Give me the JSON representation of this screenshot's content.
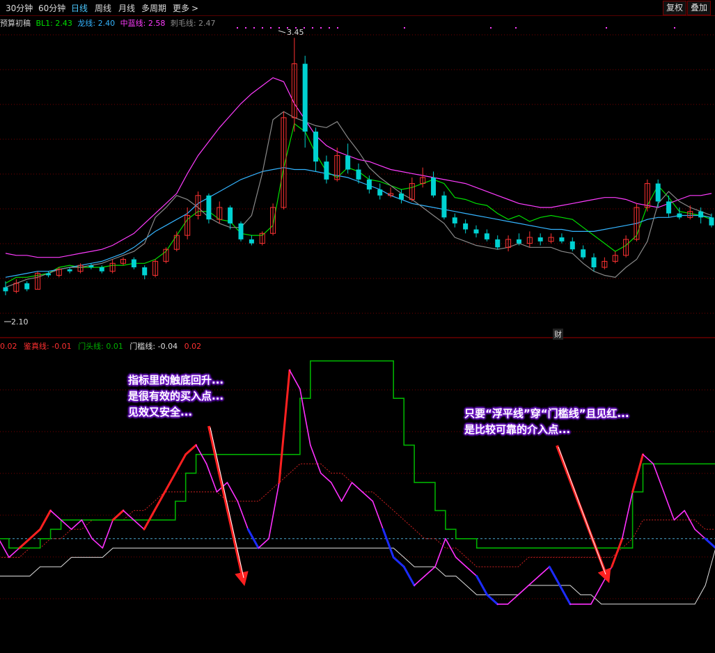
{
  "toolbar": {
    "tabs": [
      "30分钟",
      "60分钟",
      "日线",
      "周线",
      "月线",
      "多周期",
      "更多"
    ],
    "active_tab": "日线",
    "more_arrow": ">",
    "right_buttons": [
      "复权",
      "叠加"
    ]
  },
  "upper_legend": {
    "name": "预算初稿",
    "items": [
      {
        "label": "BL1:",
        "value": "2.43",
        "color": "#00e000"
      },
      {
        "label": "龙线:",
        "value": "2.40",
        "color": "#34b4ff"
      },
      {
        "label": "中蓝线:",
        "value": "2.58",
        "color": "#ff3cff"
      },
      {
        "label": "刺毛线:",
        "value": "2.47",
        "color": "#8a8a8a"
      }
    ]
  },
  "lower_legend": {
    "items": [
      {
        "label": "",
        "value": "0.02",
        "color": "#ff3030"
      },
      {
        "label": "鉴真线:",
        "value": "-0.01",
        "color": "#ff3030"
      },
      {
        "label": "门头线:",
        "value": "0.01",
        "color": "#00b000"
      },
      {
        "label": "门槛线:",
        "value": "-0.04",
        "color": "#e0e0e0"
      },
      {
        "label": "",
        "value": "0.02",
        "color": "#ff3030"
      }
    ]
  },
  "price_labels": {
    "high": "3.45",
    "low": "2.10",
    "fin_marker": "财"
  },
  "annotations": [
    {
      "lines": [
        "指标里的触底回升...",
        "是很有效的买入点...",
        "见效又安全..."
      ]
    },
    {
      "lines": [
        "只要“浮平线”穿“门槛线”且见红...",
        "是比较可靠的介入点..."
      ]
    }
  ],
  "colors": {
    "up": "#ff3232",
    "down": "#00d2d2",
    "grid": "#7a0000"
  },
  "chart_data": [
    {
      "type": "candlestick",
      "title": "预算初稿",
      "ylim": [
        2.0,
        3.5
      ],
      "series": [
        {
          "name": "BL1",
          "values": [
            2.22,
            2.25,
            2.25,
            2.26,
            2.27,
            2.3,
            2.31,
            2.3,
            2.3,
            2.3,
            2.31,
            2.31,
            2.32,
            2.32,
            2.34,
            2.38,
            2.46,
            2.54,
            2.58,
            2.58,
            2.54,
            2.53,
            2.47,
            2.46,
            2.46,
            2.51,
            2.8,
            3.02,
            2.98,
            2.87,
            2.78,
            2.75,
            2.8,
            2.78,
            2.74,
            2.73,
            2.71,
            2.69,
            2.7,
            2.72,
            2.74,
            2.72,
            2.65,
            2.64,
            2.62,
            2.61,
            2.57,
            2.54,
            2.56,
            2.53,
            2.55,
            2.56,
            2.55,
            2.54,
            2.5,
            2.46,
            2.42,
            2.38,
            2.41,
            2.46,
            2.61,
            2.71,
            2.65,
            2.58,
            2.57,
            2.56,
            2.54
          ]
        },
        {
          "name": "龙线",
          "values": [
            2.25,
            2.26,
            2.27,
            2.28,
            2.28,
            2.29,
            2.3,
            2.31,
            2.32,
            2.33,
            2.35,
            2.37,
            2.4,
            2.44,
            2.48,
            2.51,
            2.54,
            2.57,
            2.62,
            2.65,
            2.68,
            2.71,
            2.74,
            2.76,
            2.78,
            2.79,
            2.8,
            2.79,
            2.79,
            2.78,
            2.77,
            2.76,
            2.75,
            2.73,
            2.71,
            2.69,
            2.66,
            2.64,
            2.62,
            2.61,
            2.6,
            2.59,
            2.58,
            2.57,
            2.56,
            2.55,
            2.54,
            2.53,
            2.52,
            2.51,
            2.5,
            2.49,
            2.49,
            2.48,
            2.48,
            2.48,
            2.49,
            2.5,
            2.51,
            2.52,
            2.54,
            2.55,
            2.55,
            2.56,
            2.56,
            2.56,
            2.55
          ]
        },
        {
          "name": "中蓝线",
          "values": [
            2.37,
            2.36,
            2.36,
            2.35,
            2.35,
            2.35,
            2.36,
            2.37,
            2.38,
            2.39,
            2.41,
            2.44,
            2.47,
            2.52,
            2.57,
            2.62,
            2.67,
            2.77,
            2.86,
            2.93,
            3.0,
            3.06,
            3.12,
            3.17,
            3.21,
            3.25,
            3.23,
            3.12,
            3.04,
            2.96,
            2.91,
            2.88,
            2.86,
            2.84,
            2.83,
            2.81,
            2.79,
            2.78,
            2.77,
            2.76,
            2.75,
            2.74,
            2.73,
            2.72,
            2.7,
            2.68,
            2.66,
            2.64,
            2.62,
            2.61,
            2.6,
            2.6,
            2.61,
            2.62,
            2.63,
            2.64,
            2.65,
            2.65,
            2.64,
            2.62,
            2.61,
            2.6,
            2.62,
            2.64,
            2.66,
            2.66,
            2.67
          ]
        },
        {
          "name": "刺毛线",
          "values": [
            2.2,
            2.22,
            2.24,
            2.25,
            2.27,
            2.29,
            2.3,
            2.3,
            2.31,
            2.32,
            2.34,
            2.36,
            2.38,
            2.42,
            2.55,
            2.6,
            2.66,
            2.64,
            2.6,
            2.55,
            2.52,
            2.5,
            2.5,
            2.56,
            2.77,
            3.04,
            3.08,
            3.05,
            3.03,
            3.01,
            3.0,
            3.03,
            2.95,
            2.88,
            2.8,
            2.75,
            2.71,
            2.67,
            2.64,
            2.6,
            2.56,
            2.52,
            2.45,
            2.43,
            2.41,
            2.4,
            2.39,
            2.4,
            2.42,
            2.4,
            2.4,
            2.4,
            2.38,
            2.37,
            2.32,
            2.28,
            2.26,
            2.25,
            2.3,
            2.34,
            2.43,
            2.62,
            2.68,
            2.63,
            2.6,
            2.58,
            2.56
          ]
        }
      ],
      "candles": [
        [
          2.2,
          2.18,
          2.23,
          2.16
        ],
        [
          2.18,
          2.22,
          2.24,
          2.17
        ],
        [
          2.22,
          2.19,
          2.23,
          2.18
        ],
        [
          2.19,
          2.27,
          2.28,
          2.19
        ],
        [
          2.27,
          2.26,
          2.28,
          2.25
        ],
        [
          2.26,
          2.29,
          2.3,
          2.25
        ],
        [
          2.29,
          2.28,
          2.3,
          2.27
        ],
        [
          2.28,
          2.31,
          2.32,
          2.27
        ],
        [
          2.31,
          2.3,
          2.32,
          2.29
        ],
        [
          2.3,
          2.28,
          2.31,
          2.27
        ],
        [
          2.28,
          2.32,
          2.34,
          2.27
        ],
        [
          2.32,
          2.34,
          2.35,
          2.31
        ],
        [
          2.34,
          2.3,
          2.35,
          2.29
        ],
        [
          2.3,
          2.26,
          2.31,
          2.24
        ],
        [
          2.26,
          2.33,
          2.34,
          2.25
        ],
        [
          2.33,
          2.39,
          2.4,
          2.32
        ],
        [
          2.39,
          2.46,
          2.48,
          2.38
        ],
        [
          2.46,
          2.56,
          2.6,
          2.44
        ],
        [
          2.56,
          2.66,
          2.68,
          2.54
        ],
        [
          2.66,
          2.54,
          2.67,
          2.52
        ],
        [
          2.54,
          2.6,
          2.63,
          2.52
        ],
        [
          2.6,
          2.52,
          2.61,
          2.49
        ],
        [
          2.52,
          2.44,
          2.53,
          2.43
        ],
        [
          2.44,
          2.42,
          2.46,
          2.41
        ],
        [
          2.42,
          2.47,
          2.48,
          2.41
        ],
        [
          2.47,
          2.6,
          2.62,
          2.46
        ],
        [
          2.6,
          3.05,
          3.08,
          2.59
        ],
        [
          3.05,
          3.32,
          3.45,
          2.98
        ],
        [
          3.32,
          2.98,
          3.36,
          2.9
        ],
        [
          2.98,
          2.83,
          3.0,
          2.78
        ],
        [
          2.83,
          2.74,
          2.86,
          2.72
        ],
        [
          2.74,
          2.86,
          2.9,
          2.73
        ],
        [
          2.86,
          2.79,
          2.92,
          2.77
        ],
        [
          2.79,
          2.74,
          2.82,
          2.72
        ],
        [
          2.74,
          2.69,
          2.76,
          2.67
        ],
        [
          2.69,
          2.66,
          2.72,
          2.64
        ],
        [
          2.66,
          2.67,
          2.7,
          2.65
        ],
        [
          2.67,
          2.64,
          2.69,
          2.62
        ],
        [
          2.64,
          2.72,
          2.75,
          2.63
        ],
        [
          2.72,
          2.75,
          2.8,
          2.7
        ],
        [
          2.75,
          2.66,
          2.78,
          2.65
        ],
        [
          2.66,
          2.55,
          2.68,
          2.54
        ],
        [
          2.55,
          2.52,
          2.57,
          2.5
        ],
        [
          2.52,
          2.49,
          2.54,
          2.47
        ],
        [
          2.49,
          2.47,
          2.51,
          2.45
        ],
        [
          2.47,
          2.44,
          2.49,
          2.43
        ],
        [
          2.44,
          2.4,
          2.46,
          2.39
        ],
        [
          2.4,
          2.44,
          2.46,
          2.38
        ],
        [
          2.44,
          2.42,
          2.47,
          2.41
        ],
        [
          2.42,
          2.45,
          2.48,
          2.4
        ],
        [
          2.45,
          2.43,
          2.47,
          2.41
        ],
        [
          2.43,
          2.45,
          2.47,
          2.42
        ],
        [
          2.45,
          2.43,
          2.47,
          2.42
        ],
        [
          2.43,
          2.39,
          2.45,
          2.38
        ],
        [
          2.39,
          2.35,
          2.41,
          2.34
        ],
        [
          2.35,
          2.3,
          2.37,
          2.28
        ],
        [
          2.3,
          2.33,
          2.35,
          2.29
        ],
        [
          2.33,
          2.36,
          2.38,
          2.32
        ],
        [
          2.36,
          2.44,
          2.46,
          2.35
        ],
        [
          2.44,
          2.6,
          2.62,
          2.43
        ],
        [
          2.6,
          2.72,
          2.74,
          2.58
        ],
        [
          2.72,
          2.63,
          2.74,
          2.6
        ],
        [
          2.63,
          2.57,
          2.66,
          2.55
        ],
        [
          2.57,
          2.55,
          2.6,
          2.54
        ],
        [
          2.55,
          2.58,
          2.61,
          2.54
        ],
        [
          2.58,
          2.55,
          2.6,
          2.52
        ],
        [
          2.55,
          2.51,
          2.57,
          2.5
        ]
      ]
    },
    {
      "type": "line",
      "ylim": [
        -0.12,
        0.2
      ],
      "series": [
        {
          "name": "鉴真线",
          "values": [
            0.0,
            -0.02,
            -0.01,
            0.0,
            0.01,
            0.03,
            0.02,
            0.01,
            0.02,
            0.0,
            -0.01,
            0.02,
            0.03,
            0.02,
            0.01,
            0.03,
            0.05,
            0.07,
            0.09,
            0.1,
            0.08,
            0.05,
            0.06,
            0.04,
            0.01,
            -0.01,
            0.0,
            0.06,
            0.18,
            0.16,
            0.1,
            0.07,
            0.06,
            0.04,
            0.06,
            0.05,
            0.04,
            0.01,
            -0.02,
            -0.03,
            -0.05,
            -0.04,
            -0.03,
            0.0,
            -0.02,
            -0.03,
            -0.04,
            -0.06,
            -0.07,
            -0.07,
            -0.06,
            -0.05,
            -0.04,
            -0.03,
            -0.05,
            -0.07,
            -0.07,
            -0.07,
            -0.05,
            -0.03,
            0.0,
            0.05,
            0.09,
            0.08,
            0.05,
            0.02,
            0.03,
            0.01,
            0.0,
            -0.01
          ]
        },
        {
          "name": "门头线",
          "values": [
            0.0,
            -0.01,
            -0.01,
            -0.01,
            0.0,
            0.01,
            0.02,
            0.02,
            0.02,
            0.02,
            0.02,
            0.02,
            0.02,
            0.02,
            0.02,
            0.02,
            0.02,
            0.04,
            0.07,
            0.09,
            0.09,
            0.09,
            0.09,
            0.09,
            0.09,
            0.09,
            0.09,
            0.09,
            0.09,
            0.15,
            0.19,
            0.19,
            0.19,
            0.19,
            0.19,
            0.19,
            0.19,
            0.19,
            0.15,
            0.1,
            0.06,
            0.06,
            0.03,
            0.01,
            0.0,
            0.0,
            -0.01,
            -0.01,
            -0.01,
            -0.01,
            -0.01,
            -0.01,
            -0.01,
            -0.01,
            -0.01,
            -0.01,
            -0.01,
            -0.01,
            -0.01,
            -0.01,
            -0.01,
            0.05,
            0.08,
            0.08,
            0.08,
            0.08,
            0.08,
            0.08,
            0.08,
            0.08
          ]
        },
        {
          "name": "门槛线",
          "values": [
            -0.04,
            -0.04,
            -0.04,
            -0.04,
            -0.03,
            -0.03,
            -0.03,
            -0.02,
            -0.02,
            -0.02,
            -0.02,
            -0.01,
            -0.01,
            -0.01,
            -0.01,
            -0.01,
            -0.01,
            -0.01,
            -0.01,
            -0.01,
            -0.01,
            -0.01,
            -0.01,
            -0.01,
            -0.01,
            -0.01,
            -0.01,
            -0.01,
            -0.01,
            -0.01,
            -0.01,
            -0.01,
            -0.01,
            -0.01,
            -0.01,
            -0.01,
            -0.01,
            -0.01,
            -0.01,
            -0.02,
            -0.03,
            -0.03,
            -0.03,
            -0.04,
            -0.04,
            -0.05,
            -0.06,
            -0.06,
            -0.06,
            -0.06,
            -0.06,
            -0.05,
            -0.05,
            -0.05,
            -0.05,
            -0.05,
            -0.06,
            -0.06,
            -0.07,
            -0.07,
            -0.07,
            -0.07,
            -0.07,
            -0.07,
            -0.07,
            -0.07,
            -0.07,
            -0.07,
            -0.05,
            -0.01
          ]
        },
        {
          "name": "signal",
          "values": [
            -0.02,
            -0.02,
            -0.02,
            -0.01,
            -0.01,
            0.0,
            0.0,
            0.01,
            0.01,
            0.02,
            0.02,
            0.02,
            0.02,
            0.03,
            0.03,
            0.04,
            0.05,
            0.05,
            0.05,
            0.05,
            0.05,
            0.05,
            0.04,
            0.04,
            0.04,
            0.04,
            0.05,
            0.06,
            0.07,
            0.08,
            0.08,
            0.08,
            0.07,
            0.07,
            0.06,
            0.05,
            0.05,
            0.04,
            0.03,
            0.02,
            0.01,
            0.0,
            0.0,
            -0.01,
            -0.01,
            -0.02,
            -0.03,
            -0.03,
            -0.03,
            -0.03,
            -0.03,
            -0.02,
            -0.02,
            -0.02,
            -0.02,
            -0.02,
            -0.02,
            -0.02,
            -0.02,
            -0.02,
            -0.01,
            0.0,
            0.02,
            0.02,
            0.02,
            0.02,
            0.02,
            0.02,
            0.01,
            0.01
          ]
        },
        {
          "name": "zero",
          "values": [
            0.0
          ]
        }
      ]
    }
  ]
}
